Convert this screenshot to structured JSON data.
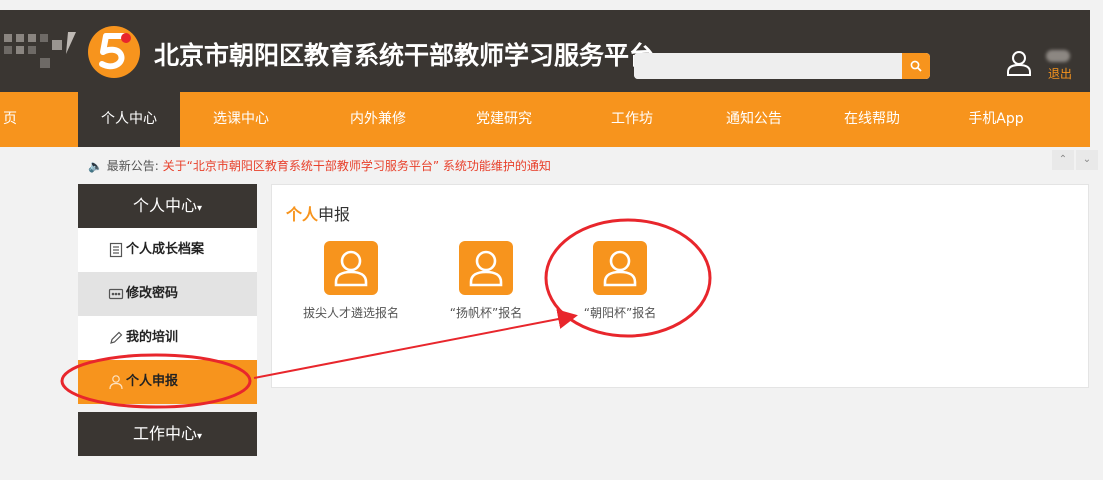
{
  "header": {
    "site_title": "北京市朝阳区教育系统干部教师学习服务平台",
    "search": {
      "placeholder": "",
      "value": ""
    },
    "user": {
      "logout_label": "退出"
    }
  },
  "nav": {
    "items": [
      {
        "label": "页"
      },
      {
        "label": "个人中心"
      },
      {
        "label": "选课中心"
      },
      {
        "label": "内外兼修"
      },
      {
        "label": "党建研究"
      },
      {
        "label": "工作坊"
      },
      {
        "label": "通知公告"
      },
      {
        "label": "在线帮助"
      },
      {
        "label": "手机App"
      }
    ],
    "active_index": 1
  },
  "notice": {
    "label": "最新公告:",
    "link_text": "关于“北京市朝阳区教育系统干部教师学习服务平台” 系统功能维护的通知"
  },
  "sidebar": {
    "section1_title": "个人中心",
    "section2_title": "工作中心",
    "items": [
      {
        "label": "个人成长档案",
        "icon": "document-icon"
      },
      {
        "label": "修改密码",
        "icon": "password-icon"
      },
      {
        "label": "我的培训",
        "icon": "pencil-icon"
      },
      {
        "label": "个人申报",
        "icon": "user-icon"
      }
    ],
    "active_index": 3
  },
  "main": {
    "title_highlight": "个人",
    "title_rest": "申报",
    "cards": [
      {
        "label": "拔尖人才遴选报名"
      },
      {
        "label": "“扬帆杯”报名"
      },
      {
        "label": "“朝阳杯”报名"
      }
    ]
  },
  "colors": {
    "brand_orange": "#f7941d",
    "header_dark": "#3a3632",
    "annotation_red": "#e8262c",
    "notice_red": "#e8412c"
  }
}
